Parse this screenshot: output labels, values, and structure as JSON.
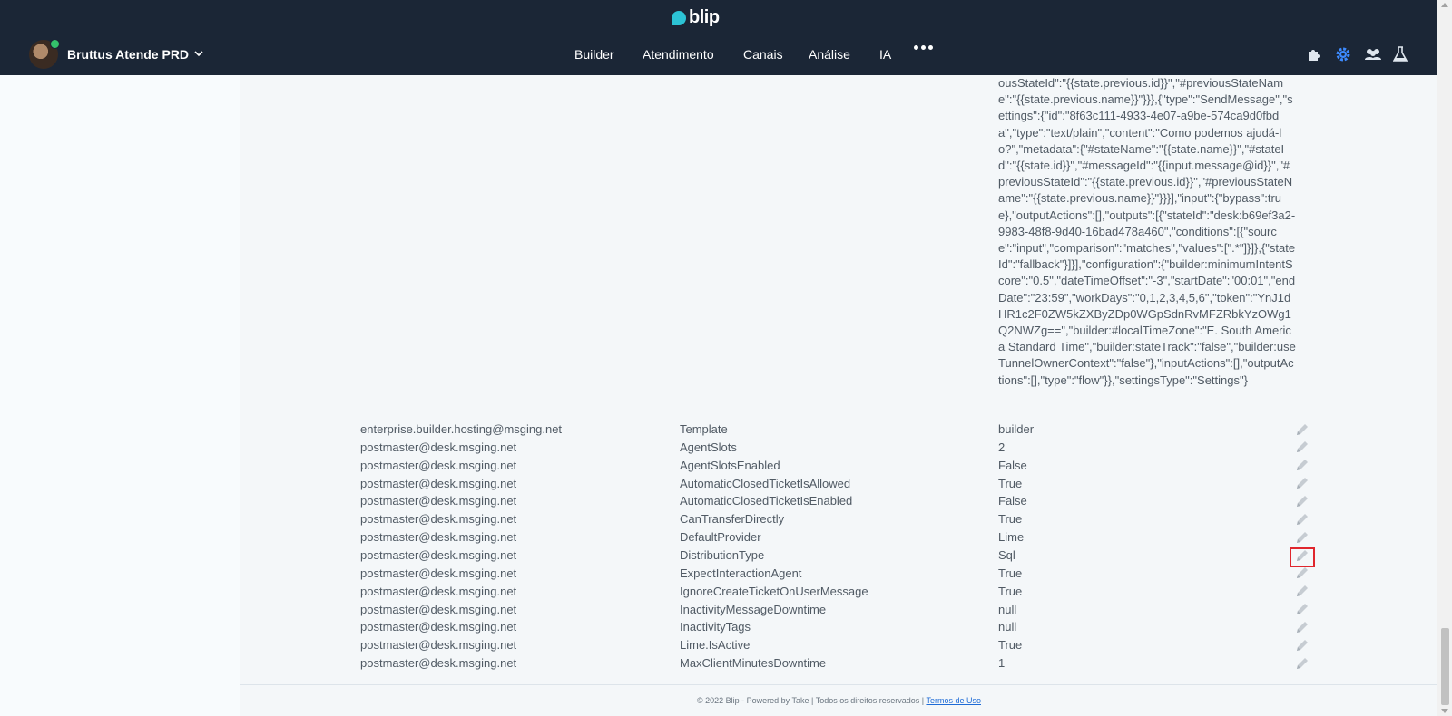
{
  "header": {
    "logo_text": "blip",
    "account_name": "Bruttus Atende PRD",
    "nav": [
      "Builder",
      "Atendimento",
      "Canais",
      "Análise",
      "IA"
    ],
    "tools": [
      "puzzle-icon",
      "gear-icon",
      "team-icon",
      "flask-icon"
    ],
    "accent": "#2cc3d5"
  },
  "json_value": "ousStateId\":\"{{state.previous.id}}\",\"#previousStateName\":\"{{state.previous.name}}\"}}},{\"type\":\"SendMessage\",\"settings\":{\"id\":\"8f63c111-4933-4e07-a9be-574ca9d0fbda\",\"type\":\"text/plain\",\"content\":\"Como podemos ajudá-lo?\",\"metadata\":{\"#stateName\":\"{{state.name}}\",\"#stateId\":\"{{state.id}}\",\"#messageId\":\"{{input.message@id}}\",\"#previousStateId\":\"{{state.previous.id}}\",\"#previousStateName\":\"{{state.previous.name}}\"}}}],\"input\":{\"bypass\":true},\"outputActions\":[],\"outputs\":[{\"stateId\":\"desk:b69ef3a2-9983-48f8-9d40-16bad478a460\",\"conditions\":[{\"source\":\"input\",\"comparison\":\"matches\",\"values\":[\".*\"]}]},{\"stateId\":\"fallback\"}]}],\"configuration\":{\"builder:minimumIntentScore\":\"0.5\",\"dateTimeOffset\":\"-3\",\"startDate\":\"00:01\",\"endDate\":\"23:59\",\"workDays\":\"0,1,2,3,4,5,6\",\"token\":\"YnJ1dHR1c2F0ZW5kZXByZDp0WGpSdnRvMFZRbkYzOWg1Q2NWZg==\",\"builder:#localTimeZone\":\"E. South America Standard Time\",\"builder:stateTrack\":\"false\",\"builder:useTunnelOwnerContext\":\"false\"},\"inputActions\":[],\"outputActions\":[],\"type\":\"flow\"}},\"settingsType\":\"Settings\"}",
  "rows": [
    {
      "owner": "enterprise.builder.hosting@msging.net",
      "name": "Template",
      "value": "builder"
    },
    {
      "owner": "postmaster@desk.msging.net",
      "name": "AgentSlots",
      "value": "2"
    },
    {
      "owner": "postmaster@desk.msging.net",
      "name": "AgentSlotsEnabled",
      "value": "False"
    },
    {
      "owner": "postmaster@desk.msging.net",
      "name": "AutomaticClosedTicketIsAllowed",
      "value": "True"
    },
    {
      "owner": "postmaster@desk.msging.net",
      "name": "AutomaticClosedTicketIsEnabled",
      "value": "False"
    },
    {
      "owner": "postmaster@desk.msging.net",
      "name": "CanTransferDirectly",
      "value": "True"
    },
    {
      "owner": "postmaster@desk.msging.net",
      "name": "DefaultProvider",
      "value": "Lime"
    },
    {
      "owner": "postmaster@desk.msging.net",
      "name": "DistributionType",
      "value": "Sql"
    },
    {
      "owner": "postmaster@desk.msging.net",
      "name": "ExpectInteractionAgent",
      "value": "True"
    },
    {
      "owner": "postmaster@desk.msging.net",
      "name": "IgnoreCreateTicketOnUserMessage",
      "value": "True"
    },
    {
      "owner": "postmaster@desk.msging.net",
      "name": "InactivityMessageDowntime",
      "value": "null"
    },
    {
      "owner": "postmaster@desk.msging.net",
      "name": "InactivityTags",
      "value": "null"
    },
    {
      "owner": "postmaster@desk.msging.net",
      "name": "Lime.IsActive",
      "value": "True"
    },
    {
      "owner": "postmaster@desk.msging.net",
      "name": "MaxClientMinutesDowntime",
      "value": "1"
    }
  ],
  "edit_icon": "pencil-icon",
  "highlighted_row_index": 7,
  "footer": {
    "text": "© 2022 Blip - Powered by Take | Todos os direitos reservados |",
    "link": "Termos de Uso"
  }
}
